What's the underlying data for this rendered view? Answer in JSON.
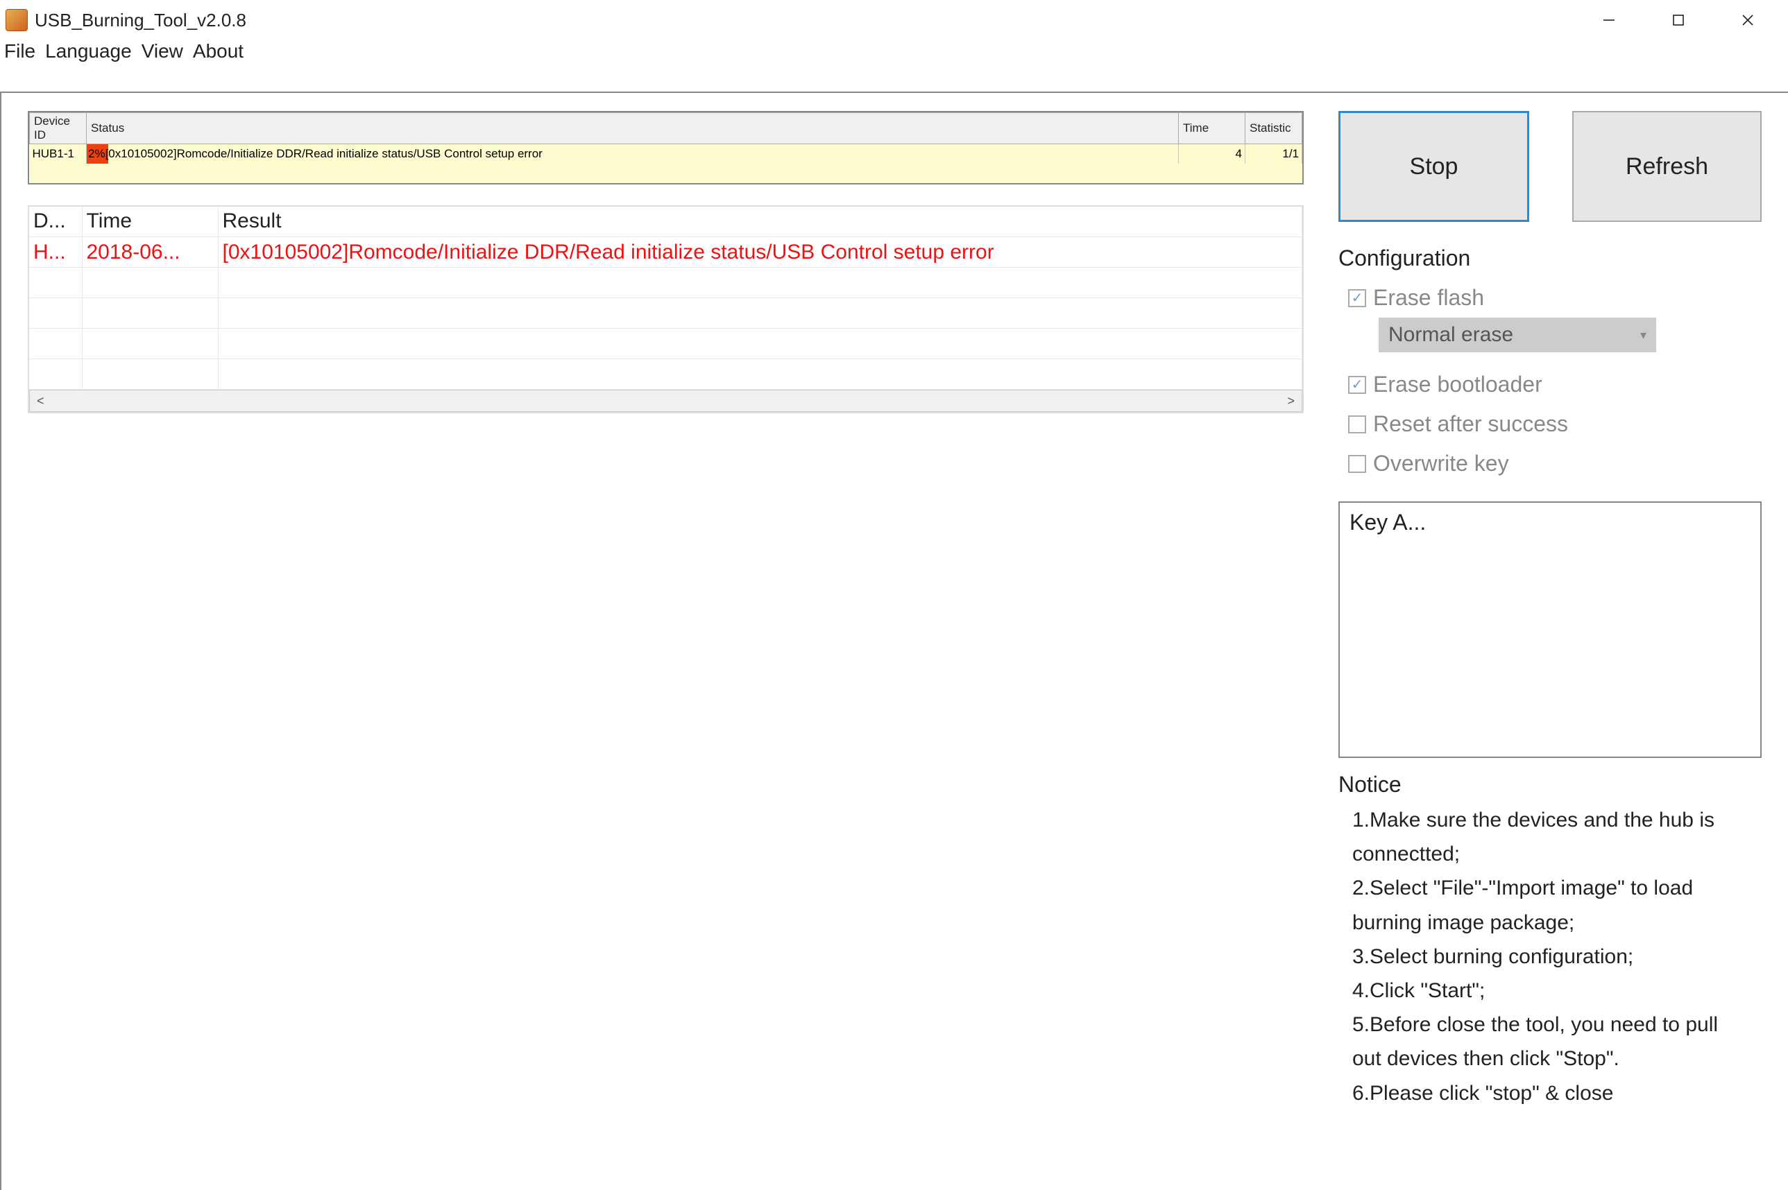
{
  "window": {
    "title": "USB_Burning_Tool_v2.0.8"
  },
  "menu": {
    "file": "File",
    "language": "Language",
    "view": "View",
    "about": "About"
  },
  "deviceTable": {
    "headers": {
      "device": "Device ID",
      "status": "Status",
      "time": "Time",
      "statistic": "Statistic"
    },
    "rows": [
      {
        "device": "HUB1-1",
        "percent": "2%",
        "status": "[0x10105002]Romcode/Initialize DDR/Read initialize status/USB Control setup error",
        "time": "4",
        "statistic": "1/1"
      }
    ]
  },
  "logTable": {
    "headers": {
      "device": "D...",
      "time": "Time",
      "result": "Result"
    },
    "rows": [
      {
        "device": "H...",
        "time": "2018-06...",
        "result": "[0x10105002]Romcode/Initialize DDR/Read initialize status/USB Control setup error"
      }
    ]
  },
  "buttons": {
    "stop": "Stop",
    "refresh": "Refresh"
  },
  "config": {
    "title": "Configuration",
    "eraseFlash": "Erase flash",
    "eraseMode": "Normal erase",
    "eraseBootloader": "Erase bootloader",
    "resetAfter": "Reset after success",
    "overwriteKey": "Overwrite key"
  },
  "keyBox": "Key A...",
  "notice": {
    "title": "Notice",
    "body": "1.Make sure the devices and the hub is connectted;\n2.Select \"File\"-\"Import image\" to load burning image package;\n3.Select burning configuration;\n4.Click \"Start\";\n5.Before close the tool, you need to pull out devices then click \"Stop\".\n6.Please click \"stop\" & close"
  }
}
